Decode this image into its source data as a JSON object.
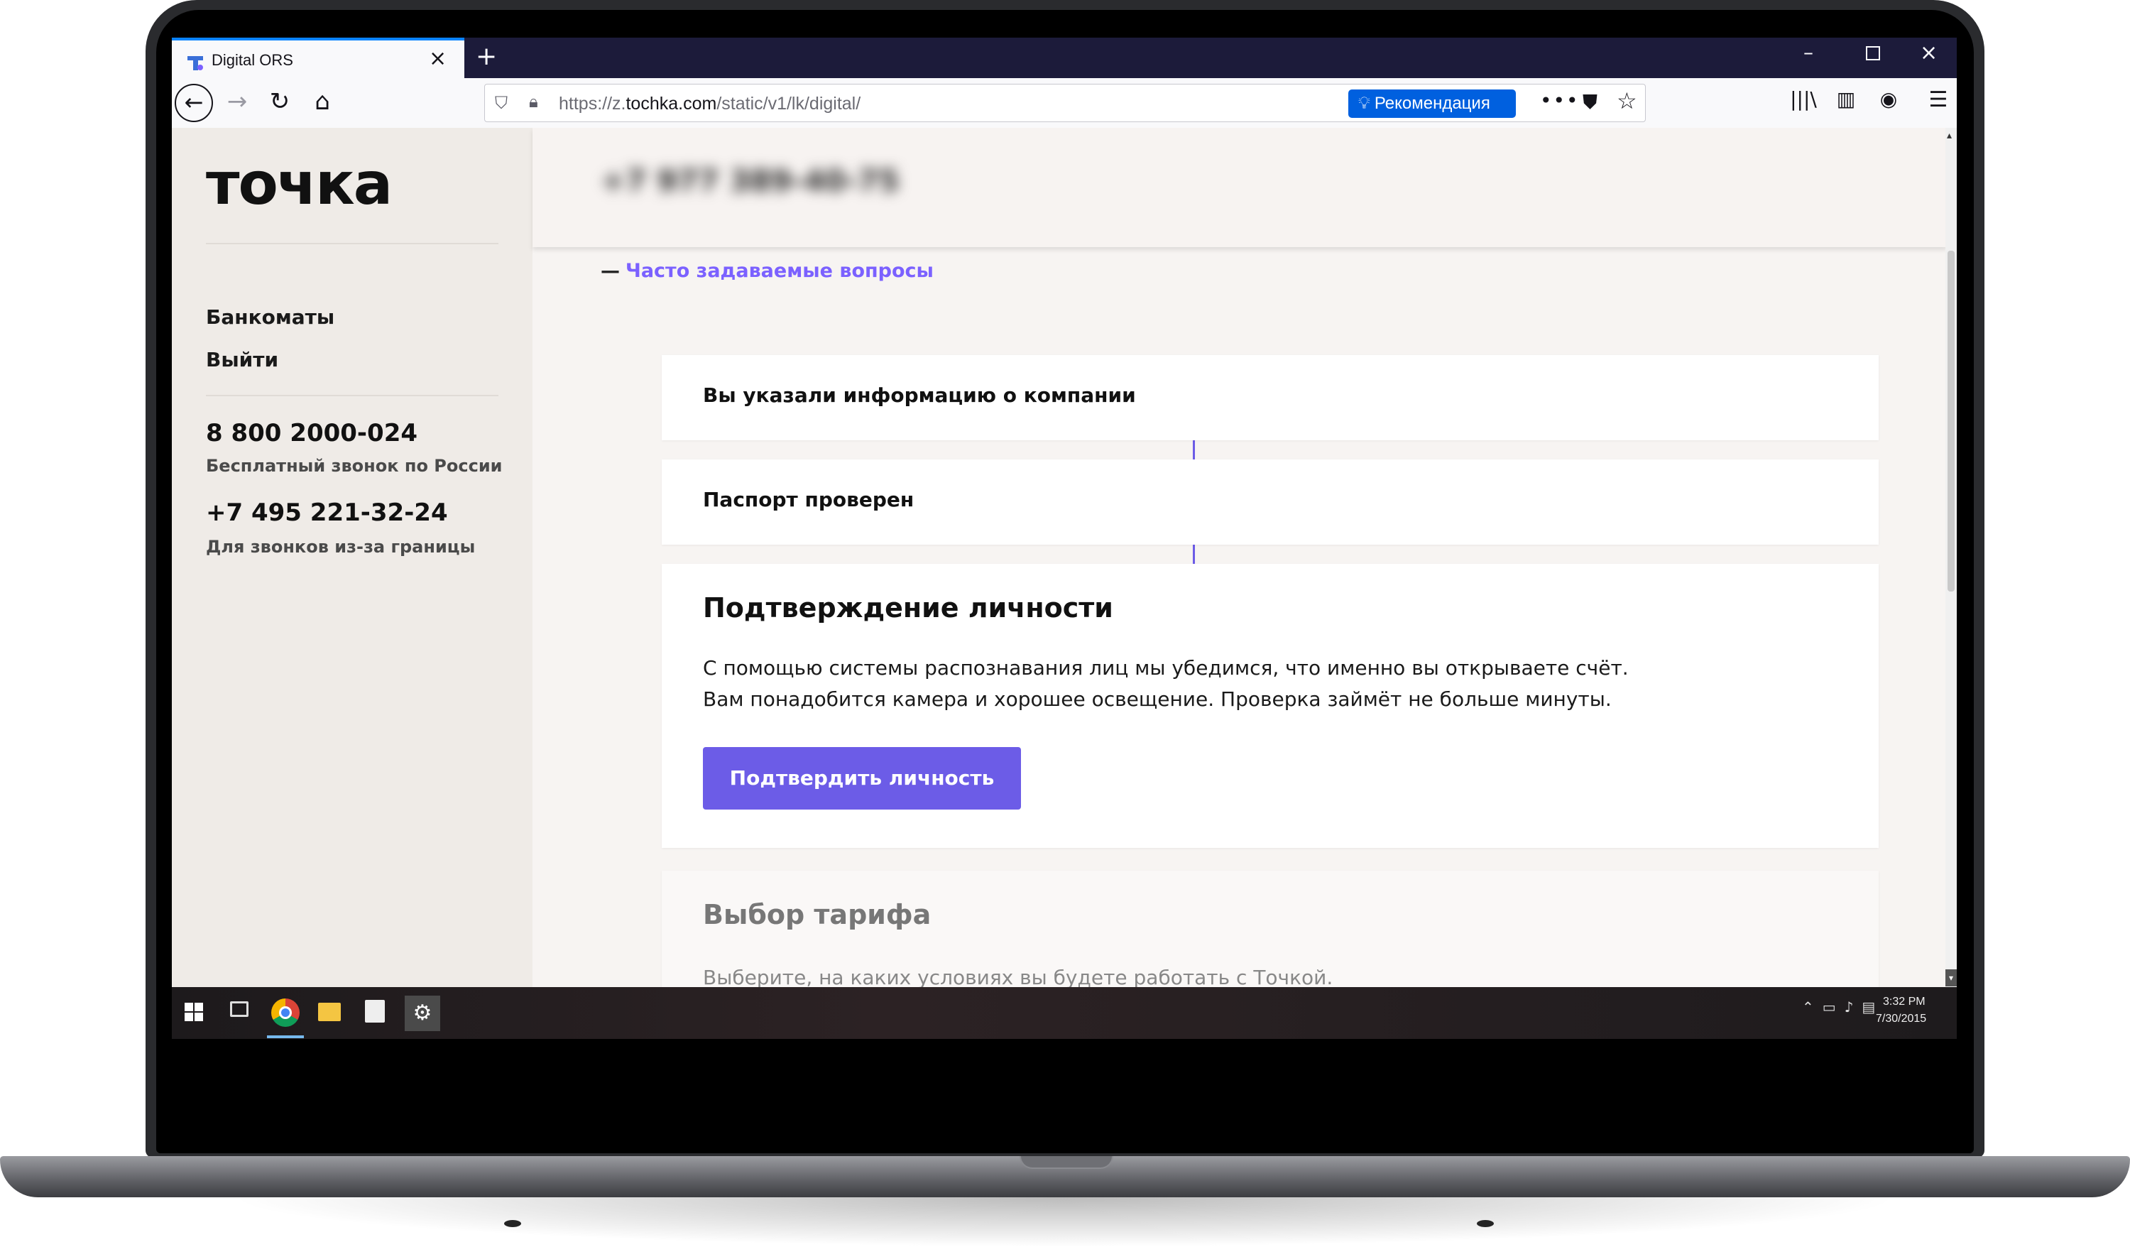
{
  "browser": {
    "tab_title": "Digital ORS",
    "url_prefix": "https://z.",
    "url_domain": "tochka.com",
    "url_path": "/static/v1/lk/digital/",
    "recommendation_label": "Рекомендация",
    "accent_color": "#0a84ff"
  },
  "sidebar": {
    "logo": "точка",
    "links": [
      "Банкоматы",
      "Выйти"
    ],
    "phone_primary": "8 800 2000-024",
    "phone_primary_caption": "Бесплатный звонок по России",
    "phone_secondary": "+7 495 221-32-24",
    "phone_secondary_caption": "Для звонков из-за границы"
  },
  "header": {
    "blurred_phone": "+7 977 389-40-75"
  },
  "faq": {
    "dash": "—",
    "label": "Часто задаваемые вопросы"
  },
  "steps": [
    {
      "title": "Вы указали информацию о компании",
      "status": "done"
    },
    {
      "title": "Паспорт проверен",
      "status": "done"
    },
    {
      "title": "Подтверждение личности",
      "status": "current",
      "description_line1": "С помощью системы распознавания лиц мы убедимся, что именно вы открываете счёт.",
      "description_line2": "Вам понадобится камера и хорошее освещение. Проверка займёт не больше минуты.",
      "button_label": "Подтвердить личность"
    },
    {
      "title": "Выбор тарифа",
      "status": "pending",
      "description": "Выберите, на каких условиях вы будете работать с Точкой."
    }
  ],
  "colors": {
    "brand_purple": "#6c5ce7",
    "faq_link": "#7b61ff",
    "sidebar_bg": "#efebe7",
    "page_bg": "#f7f4f2"
  },
  "taskbar": {
    "time": "3:32 PM",
    "date": "7/30/2015",
    "apps": [
      "windows-start-icon",
      "task-view-icon",
      "chrome-icon",
      "file-explorer-icon",
      "store-icon",
      "settings-icon"
    ]
  }
}
